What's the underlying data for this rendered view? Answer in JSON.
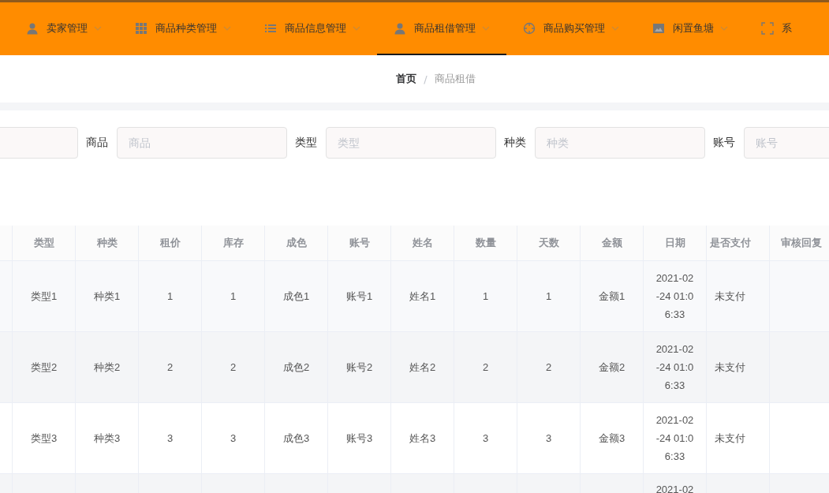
{
  "nav": [
    {
      "label": "卖家管理",
      "kind": "person",
      "selected": false
    },
    {
      "label": "商品种类管理",
      "kind": "grid",
      "selected": false
    },
    {
      "label": "商品信息管理",
      "kind": "list",
      "selected": false
    },
    {
      "label": "商品租借管理",
      "kind": "person",
      "selected": true
    },
    {
      "label": "商品购买管理",
      "kind": "compass",
      "selected": false
    },
    {
      "label": "闲置鱼塘",
      "kind": "picture",
      "selected": false
    },
    {
      "label": "系",
      "kind": "frame",
      "selected": false
    }
  ],
  "breadcrumb": {
    "items": [
      "首页",
      "商品租借"
    ],
    "separator": "/"
  },
  "search": [
    {
      "kind": "field"
    },
    {
      "kind": "labeled",
      "label": "商品",
      "placeholder": "商品"
    },
    {
      "kind": "labeled",
      "label": "类型",
      "placeholder": "类型"
    },
    {
      "kind": "labeled",
      "label": "种类",
      "placeholder": "种类"
    },
    {
      "kind": "labeled",
      "label": "账号",
      "placeholder": "账号"
    }
  ],
  "table": {
    "columns": [
      "类型",
      "种类",
      "租价",
      "库存",
      "成色",
      "账号",
      "姓名",
      "数量",
      "天数",
      "金额",
      "日期",
      "是否支付",
      "审核回复"
    ],
    "rows": [
      [
        "类型1",
        "种类1",
        "1",
        "1",
        "成色1",
        "账号1",
        "姓名1",
        "1",
        "1",
        "金额1",
        "2021-02-24 01:06:33",
        "未支付",
        ""
      ],
      [
        "类型2",
        "种类2",
        "2",
        "2",
        "成色2",
        "账号2",
        "姓名2",
        "2",
        "2",
        "金额2",
        "2021-02-24 01:06:33",
        "未支付",
        ""
      ],
      [
        "类型3",
        "种类3",
        "3",
        "3",
        "成色3",
        "账号3",
        "姓名3",
        "3",
        "3",
        "金额3",
        "2021-02-24 01:06:33",
        "未支付",
        ""
      ],
      [
        "",
        "",
        "",
        "",
        "",
        "",
        "",
        "",
        "",
        "",
        "2021-02",
        "",
        ""
      ]
    ]
  }
}
